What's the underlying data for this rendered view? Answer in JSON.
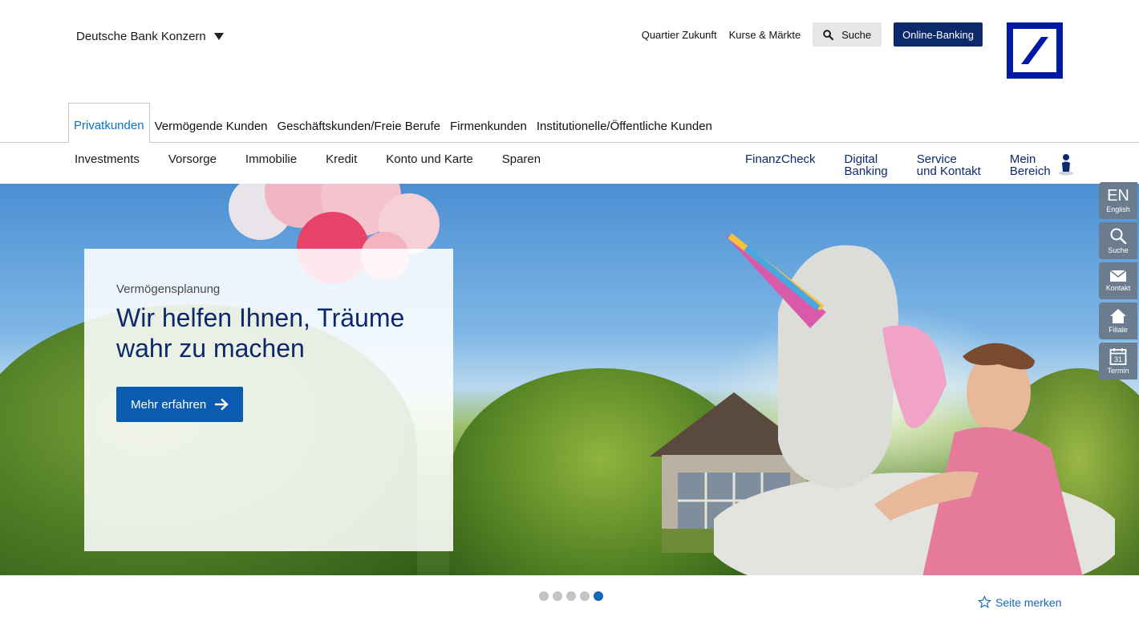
{
  "header": {
    "group_label": "Deutsche Bank Konzern",
    "links": [
      "Quartier Zukunft",
      "Kurse & Märkte"
    ],
    "search_label": "Suche",
    "online_banking_label": "Online-Banking"
  },
  "primary_nav": {
    "items": [
      {
        "label": "Privatkunden",
        "active": true
      },
      {
        "label": "Vermögende Kunden"
      },
      {
        "label": "Geschäftskunden/Freie Berufe"
      },
      {
        "label": "Firmenkunden"
      },
      {
        "label": "Institutionelle/Öffentliche Kunden"
      }
    ]
  },
  "secondary_nav": {
    "items": [
      "Investments",
      "Vorsorge",
      "Immobilie",
      "Kredit",
      "Konto und Karte",
      "Sparen"
    ],
    "right": {
      "finanzcheck": "FinanzCheck",
      "digital_1": "Digital",
      "digital_2": "Banking",
      "service_1": "Service",
      "service_2": "und Kontakt",
      "mein_1": "Mein",
      "mein_2": "Bereich"
    }
  },
  "hero": {
    "eyebrow": "Vermögensplanung",
    "headline_1": "Wir helfen Ihnen, Träume",
    "headline_2": "wahr zu machen",
    "cta_label": "Mehr erfahren"
  },
  "quickbar": {
    "lang_code": "EN",
    "lang_label": "English",
    "search_label": "Suche",
    "contact_label": "Kontakt",
    "branch_label": "Filiale",
    "appointment_label": "Termin",
    "calendar_day": "31"
  },
  "carousel": {
    "slide_count": 5,
    "active_index": 4
  },
  "bookmark_label": "Seite merken",
  "colors": {
    "brand_blue": "#0018a8",
    "navy": "#0c2a6b",
    "accent": "#0b72c4",
    "cta": "#0b5cb0"
  }
}
